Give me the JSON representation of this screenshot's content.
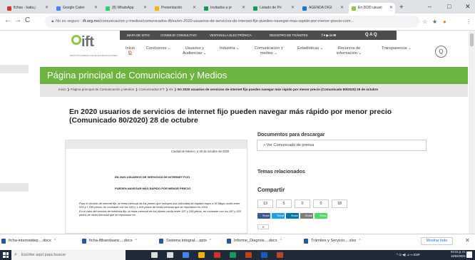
{
  "browser": {
    "tabs": [
      {
        "label": "fichas - katia.j",
        "favicon_color": "#d93025"
      },
      {
        "label": "Google Calen",
        "favicon_color": "#4285f4"
      },
      {
        "label": "(8) WhatsApp",
        "favicon_color": "#25d366"
      },
      {
        "label": "Presentación",
        "favicon_color": "#f4b400"
      },
      {
        "label": "Invitados a pr",
        "favicon_color": "#0f9d58"
      },
      {
        "label": "Listado de Pri",
        "favicon_color": "#0f9d58"
      },
      {
        "label": "AGENDA DIGI",
        "favicon_color": "#1a73e8"
      },
      {
        "label": "En 2020 usuari",
        "favicon_color": "#8dc63f"
      }
    ],
    "newtab": "+",
    "window_controls": [
      "–",
      "□",
      "✕"
    ],
    "nav": {
      "back": "←",
      "forward": "→",
      "reload": "C"
    },
    "url_warning": "▲ No es seguro",
    "url_domain": "ift.org.mx",
    "url_path": "/comunicacion-y-medios/comunicados-ift/es/en-2020-usuarios-de-servicios-de-internet-fijo-pueden-navegar-mas-rapido-por-menor-precio-com...",
    "toolbar_icons": [
      "☆",
      "★",
      "●",
      "⋮"
    ]
  },
  "site": {
    "topstrip": [
      "MAPA DE SITIO",
      "CONSEJO CONSULTIVO",
      "VENTANILLA ELECTRÓNICA",
      "REGISTRO DE TRÁMITES",
      "f  ♥  ▶  in  ✉",
      "Q  A  Q"
    ],
    "logo_text": "ift",
    "logo_sub": "INSTITUTO FEDERAL DE TELECOMUNICACIONES",
    "nav": [
      {
        "label": "Inicio\n🏠"
      },
      {
        "label": "Conócenos ⌄"
      },
      {
        "label": "Usuarios y\nAudiencias ⌄"
      },
      {
        "label": "Industria ⌄"
      },
      {
        "label": "Comunicación y\nmedios ⌄"
      },
      {
        "label": "Estadísticas ⌄"
      },
      {
        "label": "Recursos de\ninformación ⌄"
      },
      {
        "label": "Transparencia ⌄"
      }
    ],
    "search_icon": "Q",
    "section_title": "Página principal de Comunicación y Medios",
    "breadcrumb_plain": "Inicio  ❯  Página principal de Comunicación y Medios  ❯  Comunicados IFT  ❯  Es  ❯ ",
    "breadcrumb_bold": "En 2020 usuarios de servicios de internet fijo pueden navegar más rápido por menor precio (Comunicado 80/2020) 28 de octubre",
    "title": "En 2020 usuarios de servicios de internet fijo pueden navegar más rápido por menor precio (Comunicado 80/2020) 28 de octubre",
    "docs_heading": "Documentos para descargar",
    "doc_link": "» Ver Comunicado de prensa",
    "temas_heading": "Temas relacionados",
    "compartir_heading": "Compartir",
    "share_counts": [
      "13",
      "5",
      "0",
      "0",
      "18"
    ],
    "share_buttons": [
      {
        "label": "Share",
        "color": "#3b5998"
      },
      {
        "label": "Tweet",
        "color": "#1da1f2"
      },
      {
        "label": "Share",
        "color": "#0077b5"
      },
      {
        "label": "Email",
        "color": "#7f7f7f"
      },
      {
        "label": "Share",
        "color": "#4cd964"
      }
    ],
    "last_count": "9",
    "document": {
      "ciudad": "Ciudad de México, a 28 de octubre de 2020",
      "title_line1": "EN 2020 USUARIOS DE SERVICIOS DE INTERNET FIJO",
      "title_line2": "PUEDEN NAVEGAR MÁS RÁPIDO POR MENOR PRECIO",
      "bullets": [
        "Para el servicio de internet fijo, la renta mensual de los planes que incluyen una velocidad de bajada mayor a 50 Mbps oscila entre 530 y 1,049 pesos, en contraste con los 549 y 1,519 pesos de renta mensual que se reportaron en 2019.",
        "En el caso del servicio de telefonía fijo, la renta mensual de los planes oscila entre 187 y 249 pesos, en contraste con los 187 y 320 pesos de renta mensual que se reportaron en"
      ]
    }
  },
  "downloads": {
    "items": [
      "ficha-internetdep....docx",
      "ficha-iftbandaanc....docx",
      "Sistema integral....pptx",
      "Informe_Diagnós....docx",
      "Trámites y Servicio....xlsx"
    ],
    "show_all": "Mostrar todo",
    "close": "✕"
  },
  "taskbar": {
    "search_placeholder": "Escribe aquí para buscar",
    "tray": "^ ⊙ ◀) ⊿ ⇦ ESP",
    "time": "04:21 p. m.",
    "date": "15/02/2021",
    "app_colors": [
      "#dddddd",
      "#dddddd",
      "#4285f4",
      "#f4b400",
      "#d93025",
      "#0f9d58",
      "#c43e1c",
      "#185abd",
      "#b7472a"
    ]
  }
}
